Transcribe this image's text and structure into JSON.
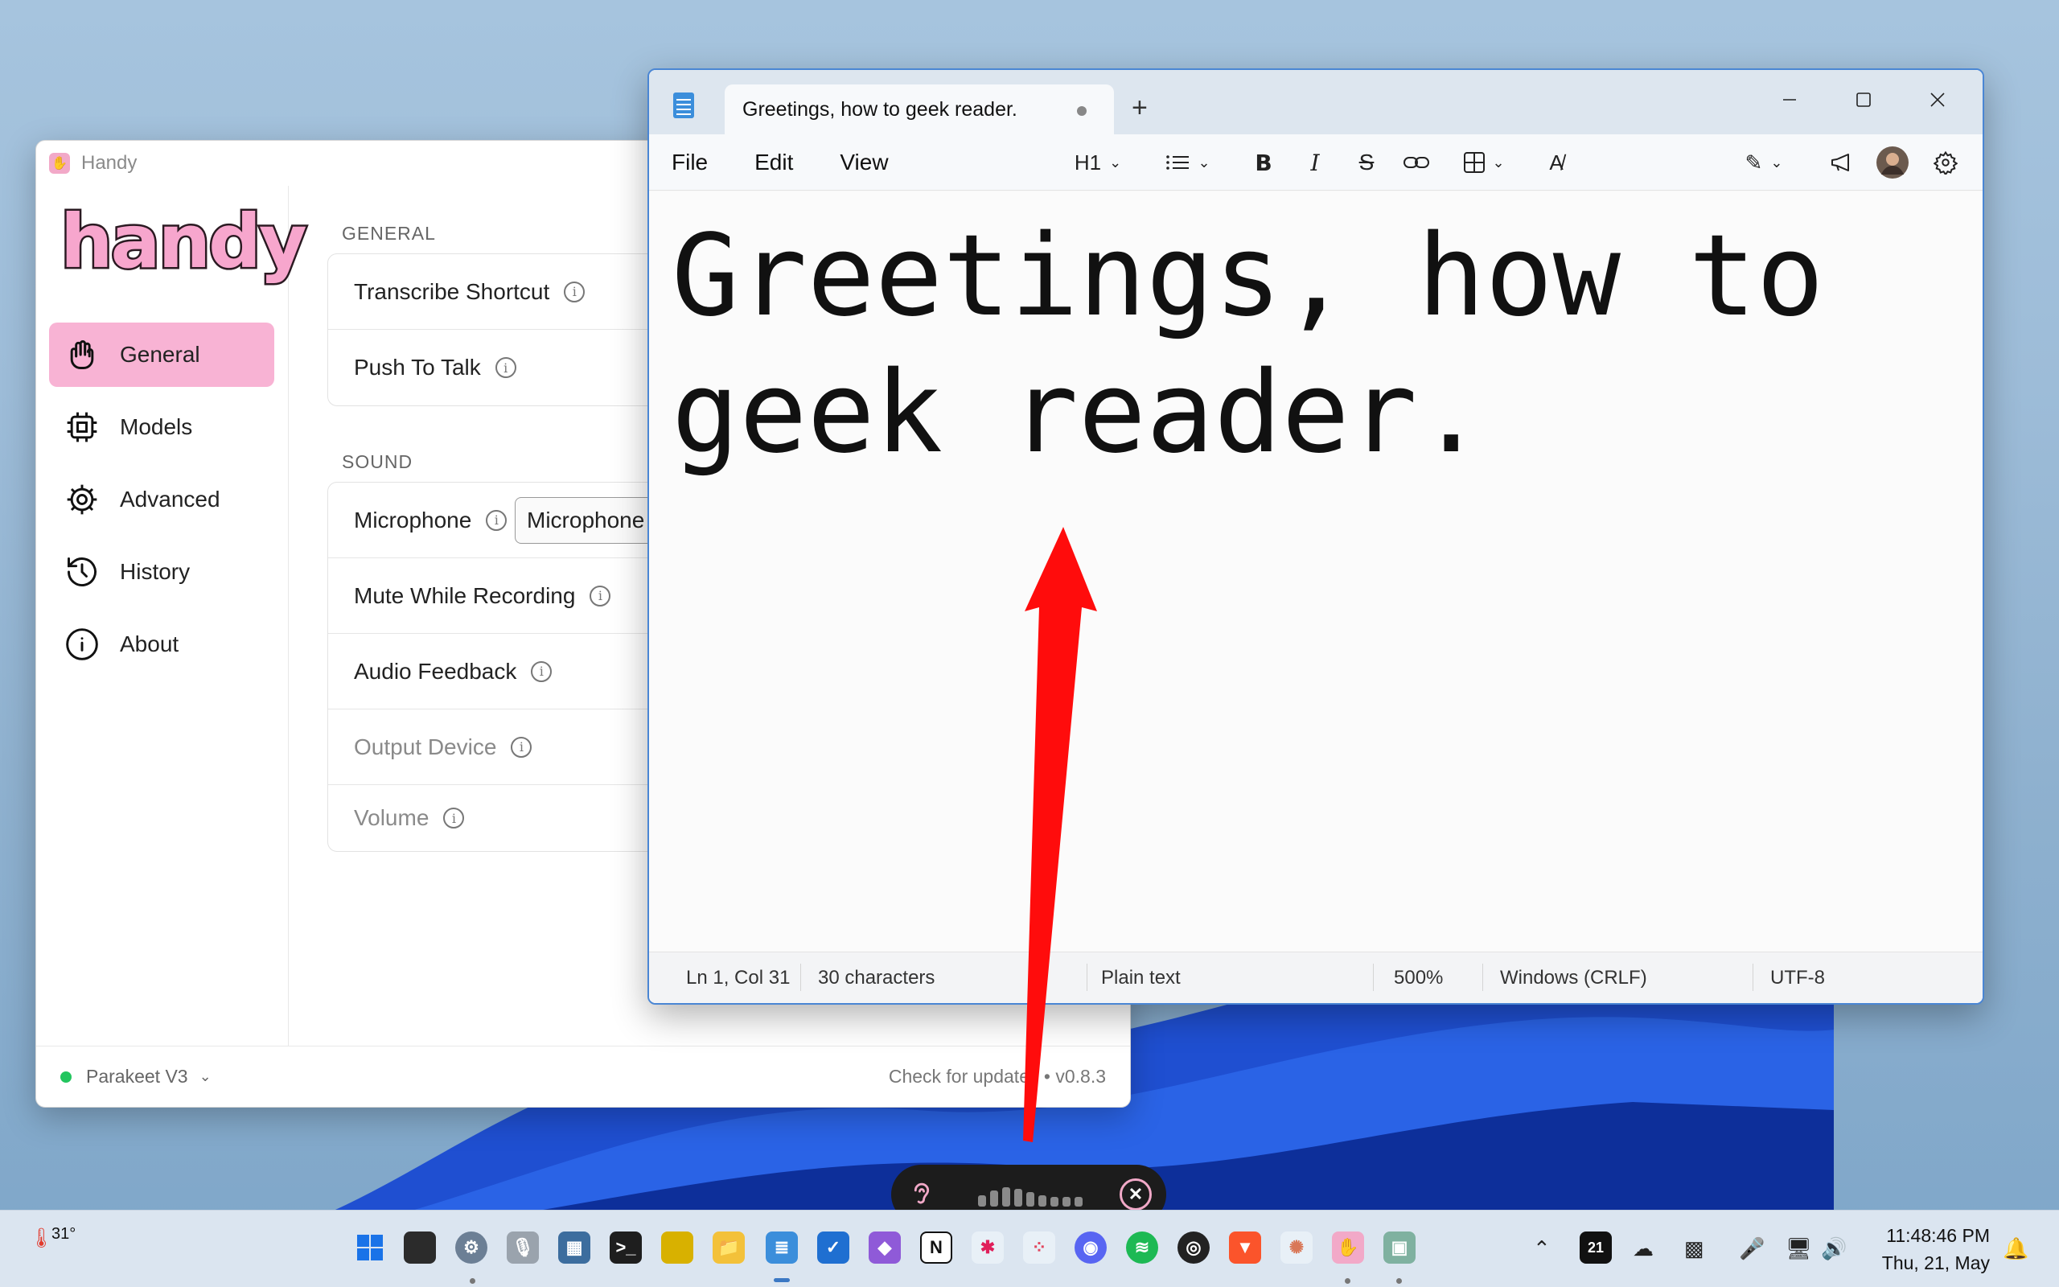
{
  "handy": {
    "title": "Handy",
    "logo_text": "handy",
    "nav": [
      {
        "label": "General",
        "icon": "hand-icon",
        "active": true
      },
      {
        "label": "Models",
        "icon": "chip-icon"
      },
      {
        "label": "Advanced",
        "icon": "gear-icon"
      },
      {
        "label": "History",
        "icon": "history-icon"
      },
      {
        "label": "About",
        "icon": "info-icon"
      }
    ],
    "general_label": "GENERAL",
    "sound_label": "SOUND",
    "general_rows": [
      "Transcribe Shortcut",
      "Push To Talk"
    ],
    "sound_rows": [
      "Microphone",
      "Mute While Recording",
      "Audio Feedback",
      "Output Device",
      "Volume"
    ],
    "microphone_select": "Microphone A",
    "footer_model": "Parakeet V3",
    "footer_update": "Check for updates",
    "footer_version": "v0.8.3",
    "accent": "#f8b3d4"
  },
  "notepad": {
    "tab_title": "Greetings, how to geek reader.",
    "new_tab": "+",
    "menu": [
      "File",
      "Edit",
      "View"
    ],
    "heading_select": "H1",
    "content": "Greetings, how to geek reader.",
    "status": {
      "position": "Ln 1, Col 31",
      "characters": "30 characters",
      "format": "Plain text",
      "zoom": "500%",
      "line_endings": "Windows (CRLF)",
      "encoding": "UTF-8"
    }
  },
  "taskbar": {
    "temperature": "31°",
    "time": "11:48:46 PM",
    "date": "Thu, 21, May",
    "calendar_day": "21"
  }
}
